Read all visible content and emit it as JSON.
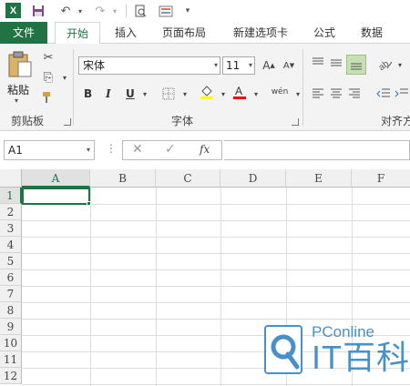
{
  "quick_access": {
    "app_icon": "excel-logo-icon",
    "icons": [
      "save-icon",
      "undo-icon",
      "redo-icon",
      "print-preview-icon",
      "form-icon",
      "customize-icon"
    ]
  },
  "tabs": {
    "file": "文件",
    "items": [
      "开始",
      "插入",
      "页面布局",
      "新建选项卡",
      "公式",
      "数据"
    ],
    "active": "开始"
  },
  "ribbon": {
    "clipboard": {
      "paste_label": "粘贴",
      "group_label": "剪贴板"
    },
    "font": {
      "font_name": "宋体",
      "font_size": "11",
      "bold": "B",
      "italic": "I",
      "underline": "U",
      "phonetic": "wén",
      "group_label": "字体"
    },
    "alignment": {
      "group_label": "对齐方"
    }
  },
  "formula_bar": {
    "name_box": "A1",
    "fx_label": "fx",
    "formula": ""
  },
  "sheet": {
    "columns": [
      "A",
      "B",
      "C",
      "D",
      "E",
      "F"
    ],
    "rows": [
      "1",
      "2",
      "3",
      "4",
      "5",
      "6",
      "7",
      "8",
      "9",
      "10",
      "11",
      "12"
    ],
    "active_cell": "A1"
  },
  "watermark": {
    "small_text": "PConline",
    "big_text": "IT百科"
  },
  "colors": {
    "excel_green": "#217346",
    "highlight_yellow": "#ffff00",
    "font_red": "#ff0000",
    "watermark_blue": "#4a90c8"
  }
}
